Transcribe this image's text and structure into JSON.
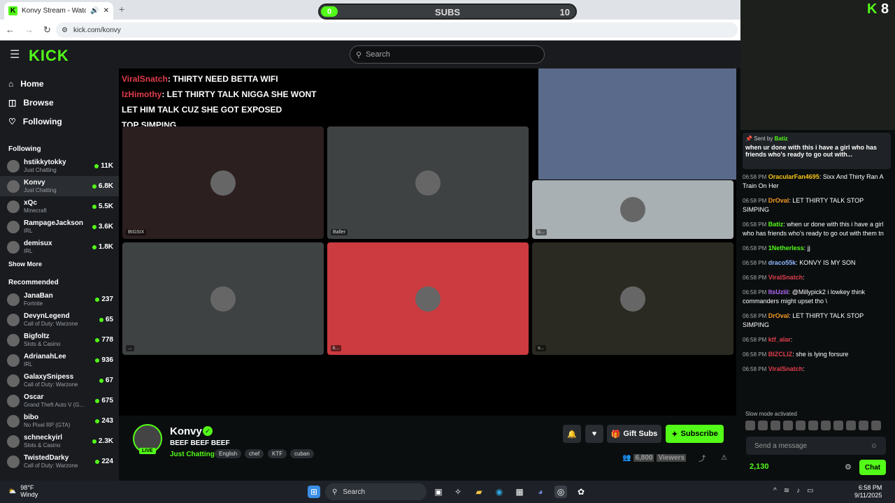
{
  "browser": {
    "tab_title": "Konvy Stream - Watch Live",
    "tab_sound_icon": "speaker-icon",
    "close_glyph": "✕",
    "new_tab_glyph": "+",
    "url": "kick.com/konvy"
  },
  "subs_goal": {
    "current": "0",
    "label": "SUBS",
    "goal": "10",
    "progress": 0
  },
  "kick_header": {
    "search_placeholder": "Search"
  },
  "sidebar": {
    "nav": [
      {
        "label": "Home",
        "icon": "home-icon"
      },
      {
        "label": "Browse",
        "icon": "browse-icon"
      },
      {
        "label": "Following",
        "icon": "heart-icon"
      }
    ],
    "following_title": "Following",
    "following": [
      {
        "name": "hstikkytokky",
        "category": "Just Chatting",
        "viewers": "11K"
      },
      {
        "name": "Konvy",
        "category": "Just Chatting",
        "viewers": "6.8K"
      },
      {
        "name": "xQc",
        "category": "Minecraft",
        "viewers": "5.5K"
      },
      {
        "name": "RampageJackson",
        "category": "IRL",
        "viewers": "3.6K"
      },
      {
        "name": "demisux",
        "category": "IRL",
        "viewers": "1.8K"
      }
    ],
    "show_more": "Show More",
    "recommended_title": "Recommended",
    "recommended": [
      {
        "name": "JanaBan",
        "category": "Fortnite",
        "viewers": "237"
      },
      {
        "name": "DevynLegend",
        "category": "Call of Duty: Warzone",
        "viewers": "65"
      },
      {
        "name": "Bigfoltz",
        "category": "Slots & Casino",
        "viewers": "778"
      },
      {
        "name": "AdrianahLee",
        "category": "IRL",
        "viewers": "936"
      },
      {
        "name": "GalaxySnipess",
        "category": "Call of Duty: Warzone",
        "viewers": "67"
      },
      {
        "name": "Oscar",
        "category": "Grand Theft Auto V (G...",
        "viewers": "675"
      },
      {
        "name": "bibo",
        "category": "No Pixel RP (GTA)",
        "viewers": "243"
      },
      {
        "name": "schneckyirl",
        "category": "Slots & Casino",
        "viewers": "2.3K"
      },
      {
        "name": "TwistedDarky",
        "category": "Call of Duty: Warzone",
        "viewers": "224"
      }
    ]
  },
  "video_overlay": [
    {
      "user": "ViralSnatch",
      "text": ": THIRTY NEED BETTA WIFI"
    },
    {
      "user": "IzHimothy",
      "text": ": LET THIRTY TALK NIGGA SHE WONT"
    },
    {
      "user": "",
      "text": "LET HIM TALK CUZ SHE GOT EXPOSED"
    },
    {
      "user": "",
      "text": "TOP SIMPING"
    }
  ],
  "call_tiles": [
    {
      "label": "BIGSIX",
      "color": "#2b1f1f"
    },
    {
      "label": "Baller",
      "color": "#3e4243"
    },
    {
      "label": "b...",
      "color": "#a8b0b3"
    },
    {
      "label": "...",
      "color": "#3e4243"
    },
    {
      "label": "k...",
      "color": "#cc3b3f"
    },
    {
      "label": "v...",
      "color": "#2a2a22"
    }
  ],
  "stream": {
    "name": "Konvy",
    "live": "LIVE",
    "title": "BEEF BEEF BEEF",
    "category": "Just Chatting",
    "tags": [
      "English",
      "chef",
      "KTF",
      "cuban"
    ],
    "gift_subs": "Gift Subs",
    "subscribe": "Subscribe",
    "viewers_count": "6,800",
    "viewers_label": "Viewers"
  },
  "chat": {
    "cam_badge": "8",
    "pinned": {
      "sent_by_label": "Sent by",
      "user": "Batiz",
      "text": "when ur done with this i have a girl who has friends who's ready to go out with..."
    },
    "messages": [
      {
        "time": "06:58 PM",
        "user": "OracularFan4695",
        "color": "#f5c518",
        "text": ": Sixx And Thirty Ran A Train On Her"
      },
      {
        "time": "06:58 PM",
        "user": "DrOval",
        "color": "#f59a23",
        "text": ": LET THIRTY TALK STOP SIMPING"
      },
      {
        "time": "06:58 PM",
        "user": "Batiz",
        "color": "#53fc18",
        "text": ": when ur done with this i have a girl who has friends who's ready to go out with them tn"
      },
      {
        "time": "06:58 PM",
        "user": "1Netherless",
        "color": "#53fc18",
        "text": ": jj"
      },
      {
        "time": "06:58 PM",
        "user": "draco55k",
        "color": "#8fb8ff",
        "text": ": KONVY IS MY SON"
      },
      {
        "time": "06:58 PM",
        "user": "ViralSnatch",
        "color": "#e03c4b",
        "text": ":"
      },
      {
        "time": "06:58 PM",
        "user": "ItsUziii",
        "color": "#b36bff",
        "text": ": @Millypick2 i lowkey think commanders might upset tho \\"
      },
      {
        "time": "06:58 PM",
        "user": "DrOval",
        "color": "#f59a23",
        "text": ": LET THIRTY TALK STOP SIMPING"
      },
      {
        "time": "06:58 PM",
        "user": "ktf_alar",
        "color": "#e03c4b",
        "text": ":"
      },
      {
        "time": "06:58 PM",
        "user": "BIZCLIZ",
        "color": "#e03c4b",
        "text": ": she is lying forsure"
      },
      {
        "time": "06:58 PM",
        "user": "ViralSnatch",
        "color": "#e03c4b",
        "text": ":"
      }
    ],
    "slow_mode": "Slow mode activated",
    "send_placeholder": "Send a message",
    "points": "2,130",
    "chat_button": "Chat"
  },
  "taskbar": {
    "temp": "98°F",
    "condition": "Windy",
    "search": "Search",
    "time": "6:58 PM",
    "date": "9/11/2025"
  },
  "colors": {
    "accent": "#53fc18",
    "bg": "#0b0e0f",
    "panel": "#191b1f"
  }
}
